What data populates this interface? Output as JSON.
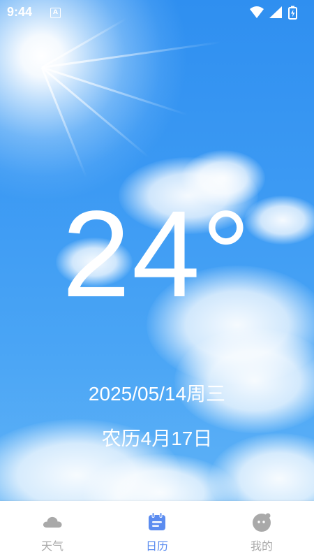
{
  "status_bar": {
    "time": "9:44",
    "notification_badge": "A",
    "icons": [
      "wifi-icon",
      "cell-signal-icon",
      "battery-charging-icon"
    ]
  },
  "weather": {
    "temperature": "24°",
    "date": "2025/05/14周三",
    "lunar_date": "农历4月17日"
  },
  "bottom_nav": {
    "items": [
      {
        "label": "天气",
        "icon": "cloud-icon",
        "active": false
      },
      {
        "label": "日历",
        "icon": "calendar-icon",
        "active": true
      },
      {
        "label": "我的",
        "icon": "profile-face-icon",
        "active": false
      }
    ]
  },
  "colors": {
    "sky_top": "#2f8ff0",
    "sky_bottom": "#5fb2f6",
    "nav_active": "#5b8cf0",
    "nav_inactive": "#a9a9a9"
  }
}
